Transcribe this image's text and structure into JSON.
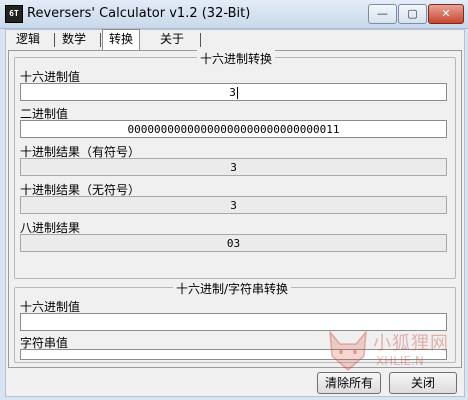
{
  "window": {
    "icon_text": "6T",
    "title": "Reversers' Calculator v1.2 (32-Bit)",
    "minimize_glyph": "—",
    "maximize_glyph": "▢",
    "close_glyph": "✕"
  },
  "tabs": [
    {
      "label": "逻辑"
    },
    {
      "label": "数学"
    },
    {
      "label": "转换"
    },
    {
      "label": "关于"
    }
  ],
  "hex_convert": {
    "title": "十六进制转换",
    "hex_label": "十六进制值",
    "hex_value": "3",
    "bin_label": "二进制值",
    "bin_value": "00000000000000000000000000000011",
    "dec_signed_label": "十进制结果（有符号）",
    "dec_signed_value": "3",
    "dec_unsigned_label": "十进制结果（无符号）",
    "dec_unsigned_value": "3",
    "oct_label": "八进制结果",
    "oct_value": "03"
  },
  "str_convert": {
    "title": "十六进制/字符串转换",
    "hex_label": "十六进制值",
    "hex_value": "",
    "str_label": "字符串值",
    "str_value": ""
  },
  "buttons": {
    "clear_all": "清除所有",
    "close": "关闭"
  },
  "watermark": {
    "text": "小狐狸网",
    "sub": "XHLIE.N"
  },
  "colors": {
    "titlebar": "#c9d8ea",
    "close_button": "#c7462f",
    "client_bg": "#f0f0f0"
  }
}
